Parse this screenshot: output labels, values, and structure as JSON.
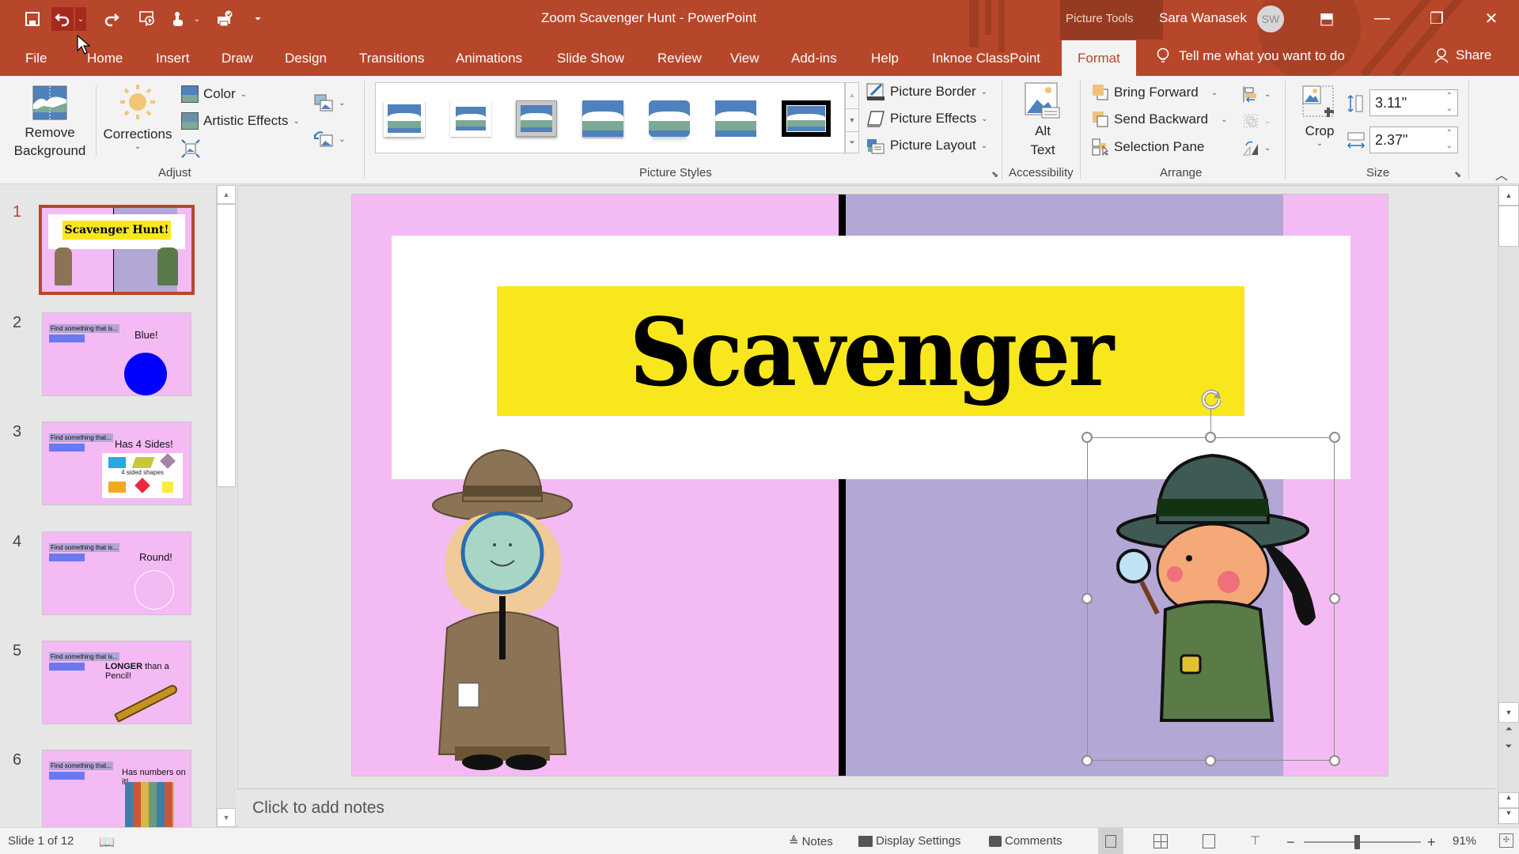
{
  "window": {
    "title": "Zoom Scavenger Hunt  -  PowerPoint",
    "context_label": "Picture Tools",
    "user_name": "Sara Wanasek",
    "user_initials": "SW",
    "quick_access": [
      "save-icon",
      "undo-icon",
      "undo-dropdown",
      "redo-icon",
      "start-from-beginning-icon",
      "touch-mode-icon",
      "touch-dropdown",
      "print-preview-icon",
      "customize-qat-icon"
    ],
    "controls": {
      "ribbon_display": "⬒",
      "minimize": "—",
      "restore": "❐",
      "close": "✕"
    }
  },
  "tabs": [
    "File",
    "Home",
    "Insert",
    "Draw",
    "Design",
    "Transitions",
    "Animations",
    "Slide Show",
    "Review",
    "View",
    "Add-ins",
    "Help",
    "Inknoe ClassPoint",
    "Format"
  ],
  "active_tab": "Format",
  "tell_me": "Tell me what you want to do",
  "share": "Share",
  "ribbon": {
    "adjust": {
      "label": "Adjust",
      "remove_background": [
        "Remove",
        "Background"
      ],
      "corrections": "Corrections",
      "color": "Color",
      "artistic_effects": "Artistic Effects"
    },
    "picture_styles": {
      "label": "Picture Styles",
      "styles": [
        "Simple Frame, White",
        "Beveled Matte, White",
        "Metal Frame",
        "Drop Shadow Rectangle",
        "Reflected Rounded Rectangle",
        "Soft Edge Rectangle",
        "Double Frame, Black"
      ],
      "picture_border": "Picture Border",
      "picture_effects": "Picture Effects",
      "picture_layout": "Picture Layout"
    },
    "accessibility": {
      "label": "Accessibility",
      "alt_text": [
        "Alt",
        "Text"
      ]
    },
    "arrange": {
      "label": "Arrange",
      "bring_forward": "Bring Forward",
      "send_backward": "Send Backward",
      "selection_pane": "Selection Pane"
    },
    "size": {
      "label": "Size",
      "crop": "Crop",
      "height": "3.11\"",
      "width": "2.37\""
    }
  },
  "thumbnails": [
    {
      "num": "1",
      "title": "Scavenger Hunt!",
      "active": true
    },
    {
      "num": "2",
      "prompt": "Find something that is...",
      "title": "Blue!"
    },
    {
      "num": "3",
      "prompt": "Find something that...",
      "title": "Has 4 Sides!",
      "caption": "4 sided shapes"
    },
    {
      "num": "4",
      "prompt": "Find something that is...",
      "title": "Round!"
    },
    {
      "num": "5",
      "prompt": "Find something that is...",
      "title_bold": "LONGER",
      "title": " than a Pencil!"
    },
    {
      "num": "6",
      "prompt": "Find something that...",
      "title": "Has numbers on it!"
    }
  ],
  "slide": {
    "title": "Scavenger Hunt!",
    "colors": {
      "background": "#f4baf4",
      "strip": "#b3a7d5",
      "title_bg": "#f9e71e",
      "divider": "#000000"
    }
  },
  "notes_placeholder": "Click to add notes",
  "status": {
    "slide_counter": "Slide 1 of 12",
    "notes": "Notes",
    "display_settings": "Display Settings",
    "comments": "Comments",
    "zoom_minus": "−",
    "zoom_plus": "+",
    "zoom": "91%",
    "zoom_fraction": 0.45
  },
  "colors": {
    "accent": "#b7472a",
    "ribbon_bg": "#f3f3f3"
  }
}
